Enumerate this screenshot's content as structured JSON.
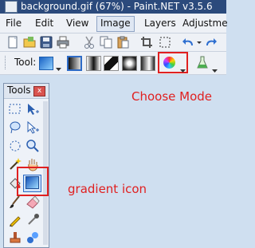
{
  "window": {
    "title": "background.gif (67%) - Paint.NET v3.5.6"
  },
  "menu": {
    "items": [
      {
        "label": "File"
      },
      {
        "label": "Edit"
      },
      {
        "label": "View"
      },
      {
        "label": "Image"
      },
      {
        "label": "Layers"
      },
      {
        "label": "Adjustme"
      }
    ]
  },
  "toolbar": {
    "tool_label": "Tool:",
    "icons": [
      "new-icon",
      "open-icon",
      "save-icon",
      "print-icon",
      "cut-icon",
      "copy-icon",
      "paste-icon",
      "crop-icon",
      "deselect-icon",
      "undo-icon",
      "redo-icon"
    ]
  },
  "tools_panel": {
    "title": "Tools",
    "close": "x"
  },
  "annotations": {
    "choose_mode": "Choose Mode",
    "gradient_icon": "gradient icon",
    "color": "#e02020"
  }
}
